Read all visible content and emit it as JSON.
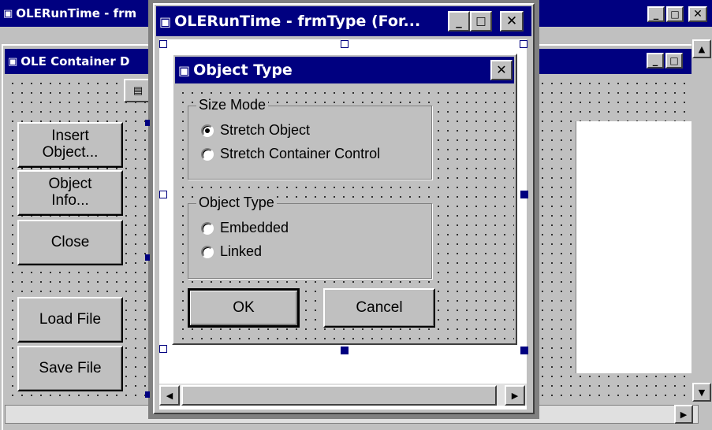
{
  "windows": {
    "back_main": {
      "title": "OLERunTime - frm"
    },
    "ole_container": {
      "title": "OLE Container D"
    },
    "frmtype": {
      "title": "OLERunTime - frmType (For..."
    },
    "object_type": {
      "title": "Object Type"
    }
  },
  "left_buttons": {
    "insert_line1": "Insert",
    "insert_line2": "Object...",
    "info_line1": "Object",
    "info_line2": "Info...",
    "close": "Close",
    "load": "Load File",
    "save": "Save File"
  },
  "dialog": {
    "size_mode": {
      "legend": "Size Mode",
      "options": [
        "Stretch Object",
        "Stretch Container Control"
      ],
      "selected": 0
    },
    "object_type": {
      "legend": "Object Type",
      "options": [
        "Embedded",
        "Linked"
      ]
    },
    "ok": "OK",
    "cancel": "Cancel"
  }
}
